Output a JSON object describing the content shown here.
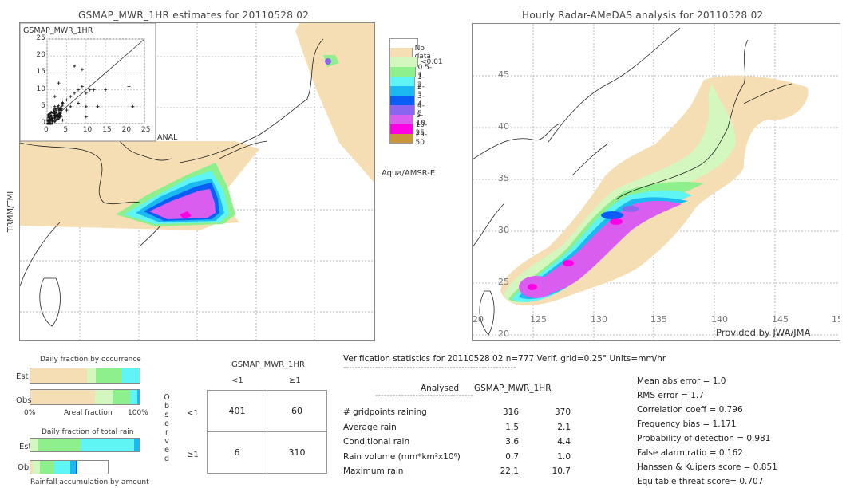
{
  "left_panel": {
    "title": "GSMAP_MWR_1HR estimates for 20110528 02",
    "side_label": "TRMM/TMI",
    "swath_label": "Aqua/AMSR-E",
    "scatter": {
      "title": "GSMAP_MWR_1HR",
      "xlabel": "ANAL",
      "ticks": [
        "0",
        "5",
        "10",
        "15",
        "20",
        "25"
      ]
    }
  },
  "right_panel": {
    "title": "Hourly Radar-AMeDAS analysis for 20110528 02",
    "credit": "Provided by JWA/JMA",
    "lat_labels": [
      "45",
      "40",
      "35",
      "30",
      "25",
      "20"
    ],
    "lon_labels": [
      "20",
      "125",
      "130",
      "135",
      "140",
      "145",
      "15"
    ]
  },
  "legend": {
    "items": [
      {
        "label": "",
        "color": "#ffffff"
      },
      {
        "label": "No data",
        "color": "#f5deb3"
      },
      {
        "label": "<0.01",
        "color": "#d4f7c0"
      },
      {
        "label": "0.5-1",
        "color": "#8ef08c"
      },
      {
        "label": "1-2",
        "color": "#5ff5f5"
      },
      {
        "label": "2-3",
        "color": "#1cb8f2"
      },
      {
        "label": "3-4",
        "color": "#0a5ef5"
      },
      {
        "label": "4-5",
        "color": "#8a66f0"
      },
      {
        "label": "5-10",
        "color": "#d95ef0"
      },
      {
        "label": "10-25",
        "color": "#ff00e6"
      },
      {
        "label": "25-50",
        "color": "#c8963c"
      }
    ]
  },
  "occurrence": {
    "title": "Daily fraction by occurrence",
    "est_label": "Est",
    "obs_label": "Obs",
    "x_left": "0%",
    "x_mid": "Areal fraction",
    "x_right": "100%",
    "est": [
      0.52,
      0.08,
      0.23,
      0.17
    ],
    "obs": [
      0.59,
      0.16,
      0.16,
      0.07,
      0.02
    ]
  },
  "total_rain": {
    "title": "Daily fraction of total rain",
    "est_label": "Est",
    "obs_label": "Obs",
    "footer": "Rainfall accumulation by amount",
    "est": [
      0.07,
      0.39,
      0.49,
      0.05
    ],
    "obs": [
      0.03,
      0.09,
      0.19,
      0.21,
      0.07,
      0.02
    ],
    "obs_total": 0.71
  },
  "contingency": {
    "title": "GSMAP_MWR_1HR",
    "col_labels": [
      "<1",
      "≥1"
    ],
    "row_labels": [
      "<1",
      "≥1"
    ],
    "observed_label": [
      "O",
      "b",
      "s",
      "e",
      "r",
      "v",
      "e",
      "d"
    ],
    "cells": [
      [
        "401",
        "60"
      ],
      [
        "6",
        "310"
      ]
    ]
  },
  "verification": {
    "header": "Verification statistics for 20110528 02   n=777   Verif. grid=0.25°   Units=mm/hr",
    "dashes": "------------------------------------------------------------",
    "col_analysed": "Analysed",
    "col_est": "GSMAP_MWR_1HR",
    "dashes2": "----------------------------------",
    "rows": [
      {
        "label": "# gridpoints raining",
        "analysed": "316",
        "est": "370"
      },
      {
        "label": "Average rain",
        "analysed": "1.5",
        "est": "2.1"
      },
      {
        "label": "Conditional rain",
        "analysed": "3.6",
        "est": "4.4"
      },
      {
        "label": "Rain volume (mm*km²x10⁶)",
        "analysed": "0.7",
        "est": "1.0"
      },
      {
        "label": "Maximum rain",
        "analysed": "22.1",
        "est": "10.7"
      }
    ],
    "scores": [
      "Mean abs error = 1.0",
      "RMS error = 1.7",
      "Correlation coeff = 0.796",
      "Frequency bias = 1.171",
      "Probability of detection = 0.981",
      "False alarm ratio = 0.162",
      "Hanssen & Kuipers score = 0.851",
      "Equitable threat score= 0.707"
    ]
  },
  "chart_data": [
    {
      "type": "scatter",
      "title": "GSMAP_MWR_1HR",
      "xlabel": "ANAL",
      "ylabel": "GSMAP_MWR_1HR",
      "xlim": [
        0,
        25
      ],
      "ylim": [
        0,
        25
      ],
      "x_ticks": [
        0,
        5,
        10,
        15,
        20,
        25
      ],
      "y_ticks": [
        0,
        5,
        10,
        15,
        20,
        25
      ],
      "grid": true,
      "note": "dense cluster of points near origin 0-8, 1:1 reference line",
      "sample_points": [
        [
          1,
          1
        ],
        [
          2,
          3
        ],
        [
          3,
          4
        ],
        [
          4,
          6
        ],
        [
          5,
          7
        ],
        [
          6,
          8
        ],
        [
          7,
          9
        ],
        [
          8,
          10
        ],
        [
          9,
          11
        ],
        [
          10,
          9
        ],
        [
          11,
          10
        ],
        [
          12,
          10
        ],
        [
          3,
          2
        ],
        [
          2,
          5
        ],
        [
          5,
          4
        ],
        [
          6,
          5
        ],
        [
          8,
          6
        ],
        [
          10,
          5
        ],
        [
          13,
          5
        ],
        [
          22,
          5
        ],
        [
          15,
          10
        ],
        [
          21,
          11
        ],
        [
          9,
          16
        ],
        [
          7,
          17
        ],
        [
          3,
          12
        ],
        [
          1,
          0
        ],
        [
          0,
          1
        ],
        [
          4,
          1
        ],
        [
          10,
          2
        ],
        [
          2,
          8
        ]
      ]
    },
    {
      "type": "bar",
      "title": "Daily fraction by occurrence",
      "categories": [
        "Est",
        "Obs"
      ],
      "series_colors": [
        "#f5deb3",
        "#d4f7c0",
        "#8ef08c",
        "#5ff5f5",
        "#1cb8f2"
      ],
      "est": [
        0.52,
        0.08,
        0.23,
        0.17
      ],
      "obs": [
        0.59,
        0.16,
        0.16,
        0.07,
        0.02
      ],
      "xlabel": "Areal fraction",
      "xlim": [
        "0%",
        "100%"
      ]
    },
    {
      "type": "bar",
      "title": "Daily fraction of total rain",
      "categories": [
        "Est",
        "Obs"
      ],
      "est": [
        0.07,
        0.39,
        0.49,
        0.05
      ],
      "obs": [
        0.03,
        0.09,
        0.19,
        0.21,
        0.07,
        0.02
      ],
      "xlabel": "Rainfall accumulation by amount"
    }
  ]
}
